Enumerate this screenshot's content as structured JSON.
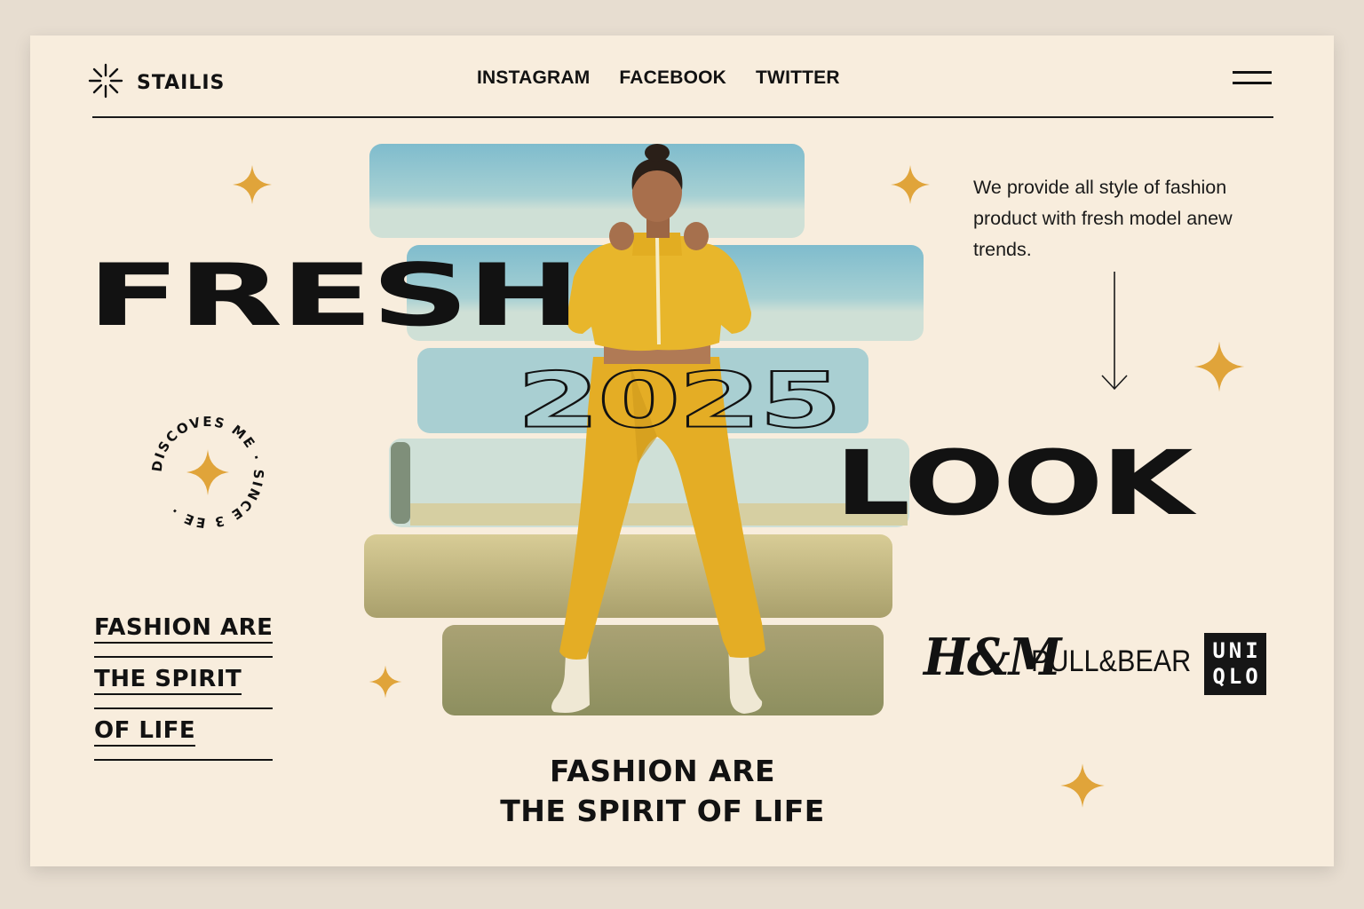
{
  "brand": {
    "name": "STAILIS",
    "icon": "sparkle-burst-icon"
  },
  "nav": [
    {
      "label": "INSTAGRAM"
    },
    {
      "label": "FACEBOOK"
    },
    {
      "label": "TWITTER"
    }
  ],
  "menu_icon": "hamburger-icon",
  "hero": {
    "word1": "FRESH",
    "year": "2025",
    "word2": "LOOK"
  },
  "description": "We provide all style of fashion product with fresh model anew trends.",
  "badge": {
    "text": "DISCOVES ME · SINCE 3 EE ·",
    "icon": "four-point-star-icon"
  },
  "tagline_left": [
    "FASHION ARE",
    "THE SPIRIT",
    "OF LIFE"
  ],
  "tagline_bottom": [
    "FASHION ARE",
    "THE SPIRIT OF LIFE"
  ],
  "brands": [
    {
      "name": "H&M"
    },
    {
      "name": "PULL&BEAR"
    },
    {
      "name": "UNIQLO",
      "lines": [
        "UNI",
        "QLO"
      ]
    }
  ],
  "colors": {
    "background": "#f8eddd",
    "ink": "#121212",
    "accent_gold": "#e0a43a",
    "sky": "#8fc6d1",
    "outfit_yellow": "#e8b62b"
  }
}
